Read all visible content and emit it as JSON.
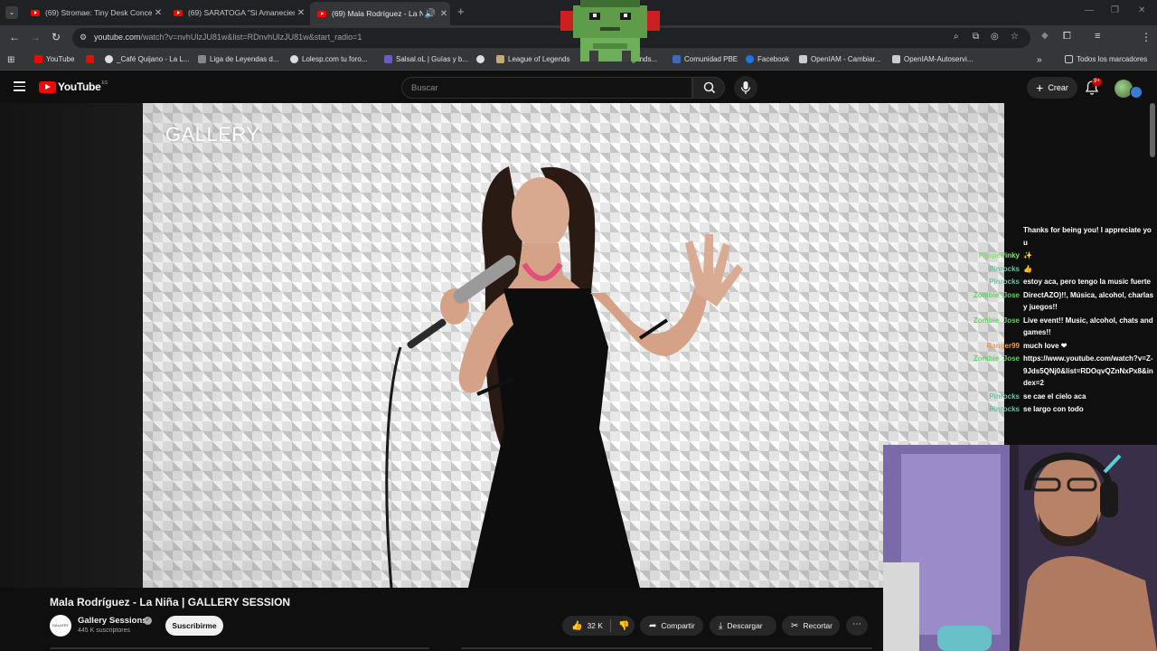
{
  "browser": {
    "tabs": [
      {
        "title": "(69) Stromae: Tiny Desk Concer",
        "active": false
      },
      {
        "title": "(69) SARATOGA \"Si Amanecier",
        "active": false
      },
      {
        "title": "(69) Mala Rodríguez - La Ni",
        "active": true
      }
    ],
    "address": {
      "host": "youtube.com",
      "path": "/watch?v=nvhUlzJU81w&list=RDnvhUlzJU81w&start_radio=1"
    },
    "bookmarks": [
      {
        "label": "YouTube",
        "icon": "youtube-icon",
        "color": "#ff0000"
      },
      {
        "label": "",
        "icon": "youtube-icon",
        "color": "#ff0000"
      },
      {
        "label": "_Café Quijano - La L...",
        "icon": "globe-icon",
        "color": "#dddddd"
      },
      {
        "label": "Liga de Leyendas d...",
        "icon": "chart-icon",
        "color": "#888888"
      },
      {
        "label": "Lolesp.com tu foro...",
        "icon": "globe-icon",
        "color": "#dddddd"
      },
      {
        "label": "Salsal.oL | Guías y b...",
        "icon": "s-icon",
        "color": "#6a5acd"
      },
      {
        "label": "",
        "icon": "globe-icon",
        "color": "#dddddd"
      },
      {
        "label": "League of Legends",
        "icon": "lol-icon",
        "color": "#c8aa6e"
      },
      {
        "label": "...gends...",
        "icon": "lol-icon",
        "color": "#c8aa6e"
      },
      {
        "label": "Comunidad PBE",
        "icon": "pbe-icon",
        "color": "#3f6ab5"
      },
      {
        "label": "Facebook",
        "icon": "facebook-icon",
        "color": "#1877f2"
      },
      {
        "label": "OpenIAM - Cambiar...",
        "icon": "openiam-icon",
        "color": "#cccccc"
      },
      {
        "label": "OpenIAM-Autoservi...",
        "icon": "openiam-icon",
        "color": "#cccccc"
      }
    ],
    "all_bookmarks": "Todos los marcadores"
  },
  "youtube": {
    "logo_text": "YouTube",
    "logo_region": "ES",
    "search_placeholder": "Buscar",
    "create_label": "Crear",
    "notification_count": "9+"
  },
  "video": {
    "watermark": "GALLERY",
    "title": "Mala Rodríguez - La Niña | GALLERY SESSION",
    "channel": "Gallery Sessions",
    "channel_avatar_text": "GALLERY",
    "subscribers": "445 K suscriptores",
    "subscribe_label": "Suscribirme",
    "likes": "32 K",
    "share_label": "Compartir",
    "download_label": "Descargar",
    "clip_label": "Recortar"
  },
  "chat": [
    {
      "user": "",
      "color": "#9fd67a",
      "text": "Thanks for being you! I appreciate you"
    },
    {
      "user": "PeppePinky",
      "color": "#7ee86a",
      "text": "✨"
    },
    {
      "user": "Pinrocks",
      "color": "#6ac0a0",
      "text": "👍"
    },
    {
      "user": "Pinrocks",
      "color": "#6ac0a0",
      "text": "estoy aca, pero tengo la music fuerte"
    },
    {
      "user": "Zombie_Jose",
      "color": "#5fd35f",
      "text": "DirectAZO)!!, Música, alcohol, charlas y juegos!!"
    },
    {
      "user": "Zombie_Jose",
      "color": "#5fd35f",
      "text": "Live event!! Music, alcohol, chats and games!!"
    },
    {
      "user": "Ranger99",
      "color": "#e0a060",
      "text": "much love ❤"
    },
    {
      "user": "Zombie_Jose",
      "color": "#5fd35f",
      "text": "https://www.youtube.com/watch?v=Z-9Jds5QNj0&list=RDOqvQZnNxPx8&index=2"
    },
    {
      "user": "Pinrocks",
      "color": "#6ac0a0",
      "text": "se cae el cielo aca"
    },
    {
      "user": "Pinrocks",
      "color": "#6ac0a0",
      "text": "se largo con todo"
    }
  ]
}
